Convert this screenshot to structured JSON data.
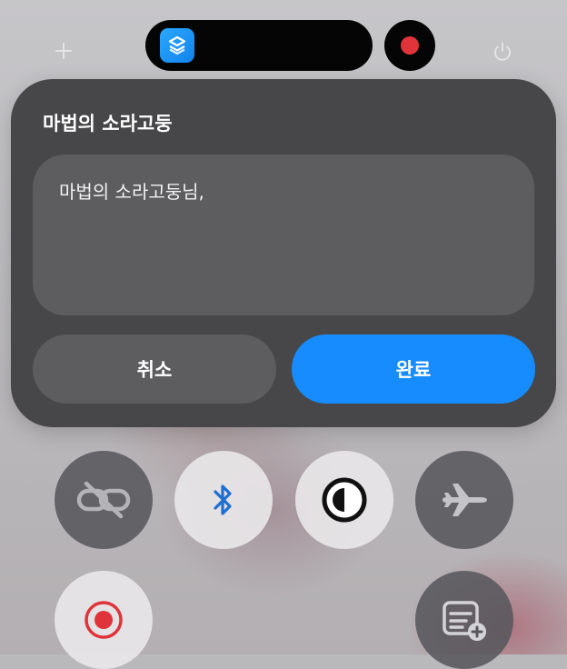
{
  "dialog": {
    "title": "마법의 소라고둥",
    "input_value": "마법의 소라고둥님,",
    "cancel_label": "취소",
    "done_label": "완료"
  },
  "status": {
    "dynamic_island_icon": "shortcuts-icon",
    "recording_indicator": "record-icon"
  },
  "control_center": {
    "buttons": [
      {
        "name": "link-off-icon",
        "active": false
      },
      {
        "name": "bluetooth-icon",
        "active": true
      },
      {
        "name": "dark-mode-icon",
        "active": true
      },
      {
        "name": "airplane-icon",
        "active": false
      },
      {
        "name": "screen-record-icon",
        "active": true
      },
      {
        "name": "add-note-icon",
        "active": false
      }
    ]
  },
  "colors": {
    "accent": "#178cff",
    "dialog_bg": "#474749",
    "field_bg": "#5d5d60",
    "record_red": "#e0343a",
    "bluetooth_blue": "#1e6fd0"
  }
}
